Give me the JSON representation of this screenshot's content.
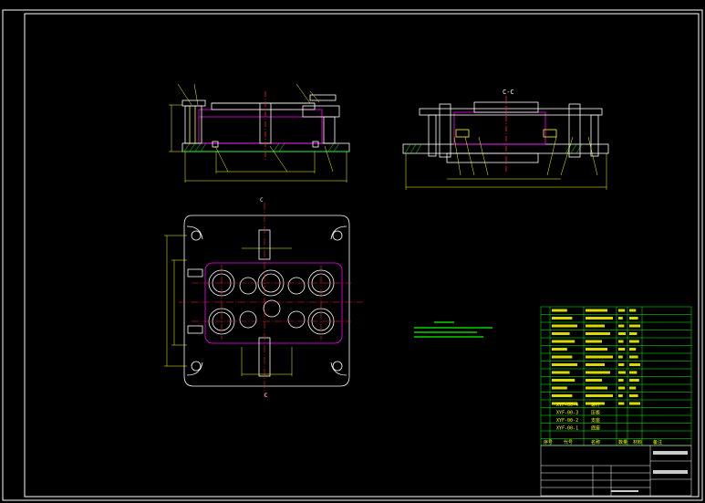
{
  "view_labels": {
    "section_title": "C-C",
    "cut_top": "C",
    "cut_bottom": "C"
  },
  "colors": {
    "background": "#000000",
    "frame": "#ffffff",
    "part_outline": "#ffffff",
    "workpiece": "#ff00ff",
    "center_line": "#ff2020",
    "dimension": "#ffff00",
    "hatch": "#00ff00",
    "table_line": "#00ff00",
    "table_text": "#ffff00"
  },
  "parts_list": {
    "rows": [
      {
        "code": "XYF-00-1",
        "name": "底座"
      },
      {
        "code": "XYF-00-2",
        "name": "支座"
      },
      {
        "code": "XYF-00-3",
        "name": "压板"
      },
      {
        "code": "XYF-00-4",
        "name": "螺杆"
      }
    ],
    "header": [
      "序号",
      "代号",
      "名称",
      "数量",
      "材料",
      "备注"
    ]
  }
}
